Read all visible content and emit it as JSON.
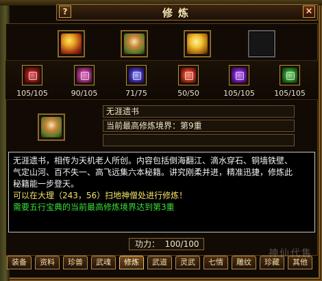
{
  "window": {
    "title": "修炼",
    "help_label": "?",
    "close_label": "×"
  },
  "treasure_slots": [
    {
      "icon": "red-book-icon"
    },
    {
      "icon": "gift-box-book-icon"
    },
    {
      "icon": "gold-book-icon"
    },
    {
      "icon": "empty-slot"
    }
  ],
  "skill_books": [
    {
      "icon": "red-scroll-icon",
      "count": "105/105"
    },
    {
      "icon": "pink-scroll-icon",
      "count": "90/105"
    },
    {
      "icon": "blue-scroll-icon",
      "count": "71/75"
    },
    {
      "icon": "orange-scroll-icon",
      "count": "50/50"
    },
    {
      "icon": "purple-scroll-icon",
      "count": "105/105"
    },
    {
      "icon": "green-scroll-icon",
      "count": "105/105"
    }
  ],
  "selected": {
    "name": "无涯遗书",
    "level_text": "当前最高修炼境界：第9重",
    "extra_text": ""
  },
  "description": {
    "line1": "无涯遗书，相传为天机老人所创。内容包括倒海翻江、滴水穿石、铜墙铁壁、",
    "line2": "气定山河、百不失一、高飞远集六本秘籍。讲究刚柔并进，精准迅捷，修炼此",
    "line3": "秘籍能一步登天。",
    "location": "可以在大理（243，56）扫地神僧处进行修炼！",
    "requirement": "需要五行宝典的当前最高修炼境界达到第3重"
  },
  "power": {
    "label": "功力：",
    "value": "100/100"
  },
  "tabs": [
    {
      "label": "装备",
      "active": false
    },
    {
      "label": "资料",
      "active": false
    },
    {
      "label": "珍兽",
      "active": false
    },
    {
      "label": "武魂",
      "active": false
    },
    {
      "label": "修炼",
      "active": true
    },
    {
      "label": "武道",
      "active": false
    },
    {
      "label": "灵武",
      "active": false
    },
    {
      "label": "七情",
      "active": false
    },
    {
      "label": "雕纹",
      "active": false
    },
    {
      "label": "珍藏",
      "active": false
    },
    {
      "label": "其他",
      "active": false
    }
  ],
  "watermark": "神仙代售"
}
